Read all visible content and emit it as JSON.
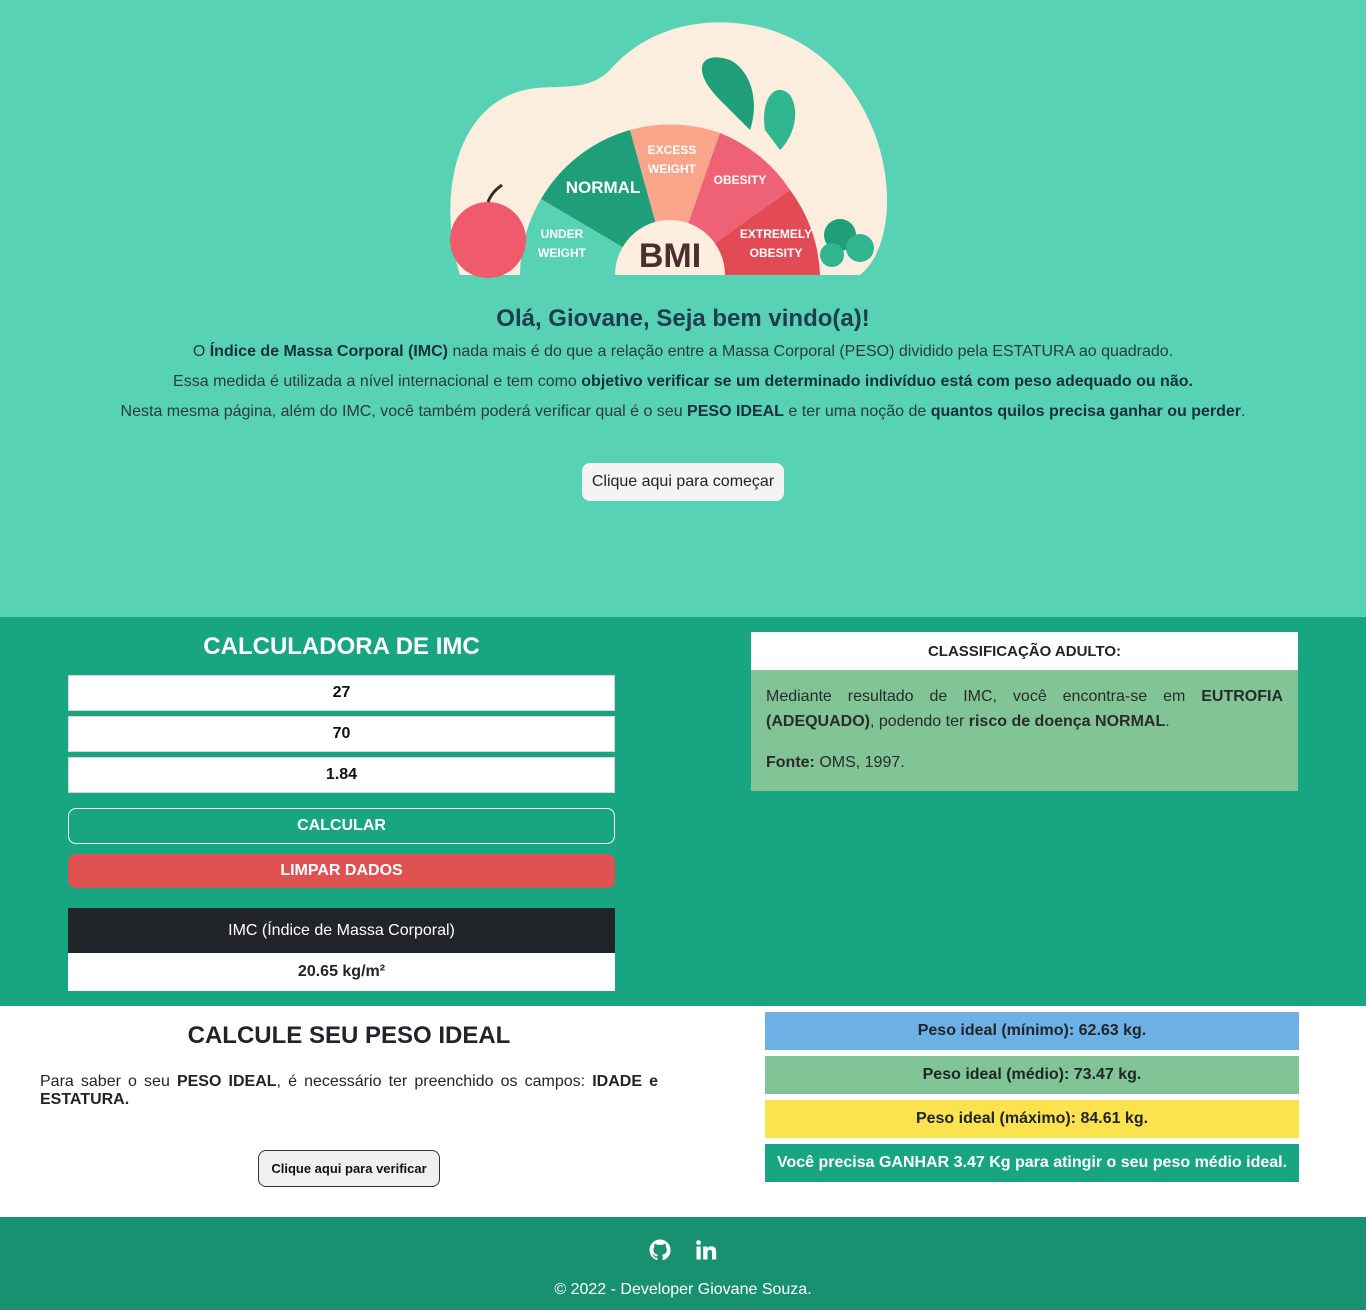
{
  "hero": {
    "gauge_labels": {
      "under_line1": "UNDER",
      "under_line2": "WEIGHT",
      "normal": "NORMAL",
      "excess_line1": "EXCESS",
      "excess_line2": "WEIGHT",
      "obesity": "OBESITY",
      "extreme_line1": "EXTREMELY",
      "extreme_line2": "OBESITY",
      "center": "BMI"
    },
    "title": "Olá, Giovane, Seja bem vindo(a)!",
    "line1": {
      "pre": "O ",
      "bold": "Índice de Massa Corporal (IMC)",
      "post": " nada mais é do que a relação entre a Massa Corporal (PESO) dividido pela ESTATURA ao quadrado."
    },
    "line2": {
      "pre": "Essa medida é utilizada a nível internacional e tem como ",
      "bold": "objetivo verificar se um determinado indivíduo está com peso adequado ou não."
    },
    "line3": {
      "pre": "Nesta mesma página, além do IMC, você também poderá verificar qual é o seu ",
      "bold1": "PESO IDEAL",
      "mid": " e ter uma noção de ",
      "bold2": "quantos quilos precisa ganhar ou perder",
      "post": "."
    },
    "start_button": "Clique aqui para começar"
  },
  "calculator": {
    "title": "CALCULADORA DE IMC",
    "age_value": "27",
    "weight_value": "70",
    "height_value": "1.84",
    "calc_button": "CALCULAR",
    "clear_button": "LIMPAR DADOS",
    "result_label": "IMC (Índice de Massa Corporal)",
    "result_value": "20.65 kg/m²"
  },
  "classification": {
    "title": "CLASSIFICAÇÃO ADULTO:",
    "pre": "Mediante resultado de IMC, você encontra-se em ",
    "bold1": "EUTROFIA (ADEQUADO)",
    "mid": ", podendo ter ",
    "bold2": "risco de doença NORMAL",
    "post": ".",
    "source_label": "Fonte:",
    "source_value": " OMS, 1997."
  },
  "ideal_weight": {
    "title": "CALCULE SEU PESO IDEAL",
    "text_pre": "Para saber o seu ",
    "text_bold1": "PESO IDEAL",
    "text_mid": ", é necessário ter preenchido os campos: ",
    "text_bold2": "IDADE e ESTATURA.",
    "verify_button": "Clique aqui para verificar",
    "min": "Peso ideal (mínimo): 62.63 kg.",
    "med": "Peso ideal (médio): 73.47 kg.",
    "max": "Peso ideal (máximo): 84.61 kg.",
    "message": "Você precisa GANHAR 3.47 Kg para atingir o seu peso médio ideal."
  },
  "footer": {
    "icons": [
      "github-icon",
      "linkedin-icon"
    ],
    "copyright": "© 2022 - Developer Giovane Souza."
  },
  "colors": {
    "hero_bg": "#58d2b5",
    "calc_bg": "#18a582",
    "footer_bg": "#179170",
    "clear_red": "#e05252",
    "min_blue": "#6cb0e6",
    "med_green": "#81c495",
    "max_yellow": "#fbe34d"
  }
}
